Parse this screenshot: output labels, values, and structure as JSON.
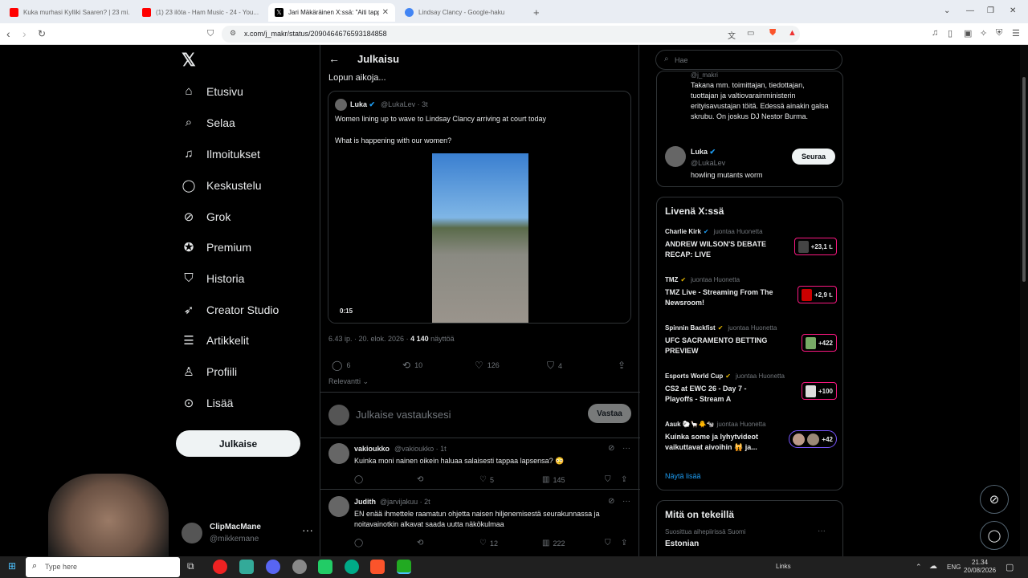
{
  "browser": {
    "tabs": [
      {
        "title": "Kuka murhasi Kylliki Saaren? | 23 mi…",
        "icon": "youtube-icon",
        "color": "#ff0000"
      },
      {
        "title": "(1) 23 ilöta - Ham Music - 24 - You...",
        "icon": "youtube-icon",
        "color": "#ff0000"
      },
      {
        "title": "Jari Mäkäräinen X:ssä: \"Aiti tapp…",
        "icon": "x-icon",
        "color": "#000000"
      },
      {
        "title": "Lindsay Clancy - Google-haku",
        "icon": "google-icon",
        "color": "#4285f4"
      }
    ],
    "url": "x.com/j_makr/status/2090464676593184858",
    "new_tab": "+"
  },
  "nav": {
    "logo": "𝕏",
    "items": [
      {
        "label": "Etusivu",
        "icon": "home-icon",
        "glyph": "⌂"
      },
      {
        "label": "Selaa",
        "icon": "search-icon",
        "glyph": "⌕"
      },
      {
        "label": "Ilmoitukset",
        "icon": "bell-icon",
        "glyph": "♫"
      },
      {
        "label": "Keskustelu",
        "icon": "chat-icon",
        "glyph": "◯"
      },
      {
        "label": "Grok",
        "icon": "grok-icon",
        "glyph": "⊘"
      },
      {
        "label": "Premium",
        "icon": "premium-icon",
        "glyph": "✪"
      },
      {
        "label": "Historia",
        "icon": "bookmark-icon",
        "glyph": "⛉"
      },
      {
        "label": "Creator Studio",
        "icon": "rocket-icon",
        "glyph": "➶"
      },
      {
        "label": "Artikkelit",
        "icon": "article-icon",
        "glyph": "☰"
      },
      {
        "label": "Profiili",
        "icon": "profile-icon",
        "glyph": "♙"
      },
      {
        "label": "Lisää",
        "icon": "more-icon",
        "glyph": "⊙"
      }
    ],
    "post_button": "Julkaise",
    "account": {
      "name": "ClipMacMane",
      "handle": "@mikkemane",
      "more": "···"
    }
  },
  "main": {
    "back": "←",
    "title": "Julkaisu",
    "lead_text": "Lopun aikoja...",
    "quote": {
      "name": "Luka",
      "handle": "@LukaLev · 3t",
      "line1": "Women lining up to wave to Lindsay Clancy arriving at court today",
      "line2": "What is happening with our women?",
      "video_time": "0:15"
    },
    "meta": {
      "time": "6.43 ip. · 20. elok. 2026 · ",
      "views": "4 140",
      "views_label": " näyttöä"
    },
    "actions": {
      "replies": "6",
      "reposts": "10",
      "likes": "126",
      "bookmarks": "4"
    },
    "sort": "Relevantti ⌄",
    "reply_placeholder": "Julkaise vastauksesi",
    "reply_button": "Vastaa",
    "replies": [
      {
        "name": "vakioukko",
        "handle": "@vakioukko · 1t",
        "text": "Kuinka moni nainen oikein haluaa salaisesti tappaa lapsensa? 😳",
        "reply": "",
        "repost": "",
        "likes": "5",
        "views": "145"
      },
      {
        "name": "Judith",
        "handle": "@jarvijakuu · 2t",
        "text": "EN enää ihmettele raamatun ohjetta naisen hiljenemisestä seurakunnassa ja noitavainotkin alkavat saada uutta näkökulmaa",
        "reply": "",
        "repost": "",
        "likes": "12",
        "views": "222"
      }
    ]
  },
  "right": {
    "search_placeholder": "Hae",
    "follow": {
      "partial_handle": "@j_makri",
      "bio": "Takana mm. toimittajan, tiedottajan, tuottajan ja valtiovarainministerin erityisavustajan töitä. Edessä ainakin galsa skrubu. On joskus DJ Nestor Burma.",
      "user_name": "Luka",
      "user_handle": "@LukaLev",
      "user_bio": "howling mutants worm",
      "follow_button": "Seuraa"
    },
    "live": {
      "title": "Livenä X:ssä",
      "items": [
        {
          "host": "Charlie Kirk",
          "hosting": "juontaa Huonetta",
          "title": "ANDREW WILSON'S DEBATE RECAP: LIVE",
          "count": "+23,1 t."
        },
        {
          "host": "TMZ",
          "hosting": "juontaa Huonetta",
          "title": "TMZ Live - Streaming From The Newsroom!",
          "count": "+2,9 t."
        },
        {
          "host": "Spinnin Backfist",
          "hosting": "juontaa Huonetta",
          "title": "UFC SACRAMENTO BETTING PREVIEW",
          "count": "+422"
        },
        {
          "host": "Esports World Cup",
          "hosting": "juontaa Huonetta",
          "title": "CS2 at EWC 26 - Day 7 - Playoffs - Stream A",
          "count": "+100"
        },
        {
          "host": "Aauk 🐑🦙🐥🐄",
          "hosting": "juontaa Huonetta",
          "title": "Kuinka some ja lyhytvideot vaikuttavat aivoihin 🙀 ja...",
          "count": "+42"
        }
      ],
      "show_more": "Näytä lisää"
    },
    "happening": {
      "title": "Mitä on tekeillä",
      "subtitle": "Suosittua aihepiirissä Suomi",
      "topic": "Estonian",
      "more": "···"
    }
  },
  "taskbar": {
    "search_placeholder": "Type here",
    "links": "Links",
    "lang": "ENG",
    "time": "21.34",
    "date": "20/08/2026"
  }
}
